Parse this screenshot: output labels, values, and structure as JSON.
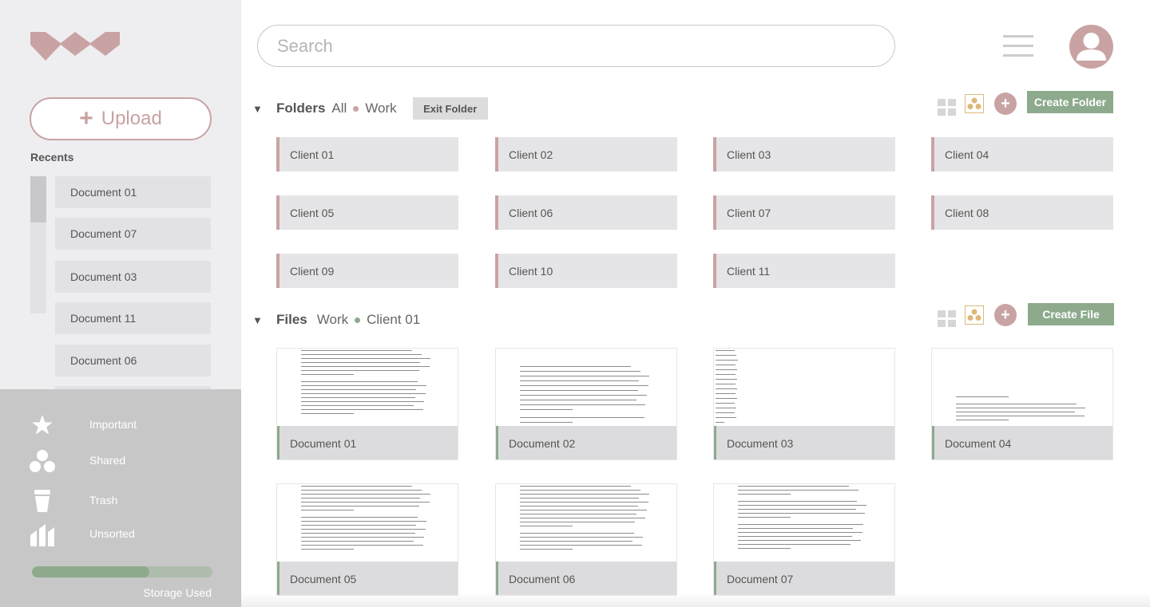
{
  "sidebar": {
    "upload_label": "Upload",
    "recents_title": "Recents",
    "recents": [
      "Document 01",
      "Document 07",
      "Document 03",
      "Document 11",
      "Document 06"
    ],
    "nav": [
      {
        "label": "Important",
        "icon": "star-icon"
      },
      {
        "label": "Shared",
        "icon": "shared-circles-icon"
      },
      {
        "label": "Trash",
        "icon": "trash-icon"
      },
      {
        "label": "Unsorted",
        "icon": "unsorted-icon"
      }
    ],
    "storage": {
      "label": "Storage Used",
      "used_fraction": 0.65
    }
  },
  "header": {
    "search_placeholder": "Search"
  },
  "folders": {
    "title": "Folders",
    "crumbs": [
      "All",
      "Work"
    ],
    "exit_label": "Exit Folder",
    "create_label": "Create Folder",
    "items": [
      "Client 01",
      "Client 02",
      "Client 03",
      "Client 04",
      "Client 05",
      "Client 06",
      "Client 07",
      "Client 08",
      "Client 09",
      "Client 10",
      "Client 11"
    ]
  },
  "files": {
    "title": "Files",
    "crumbs": [
      "Work",
      "Client 01"
    ],
    "create_label": "Create File",
    "items": [
      "Document 01",
      "Document 02",
      "Document 03",
      "Document 04",
      "Document 05",
      "Document 06",
      "Document 07"
    ]
  },
  "colors": {
    "accent_rose": "#c9a3a3",
    "accent_green": "#8daa8d",
    "accent_gold": "#dcb97a"
  }
}
